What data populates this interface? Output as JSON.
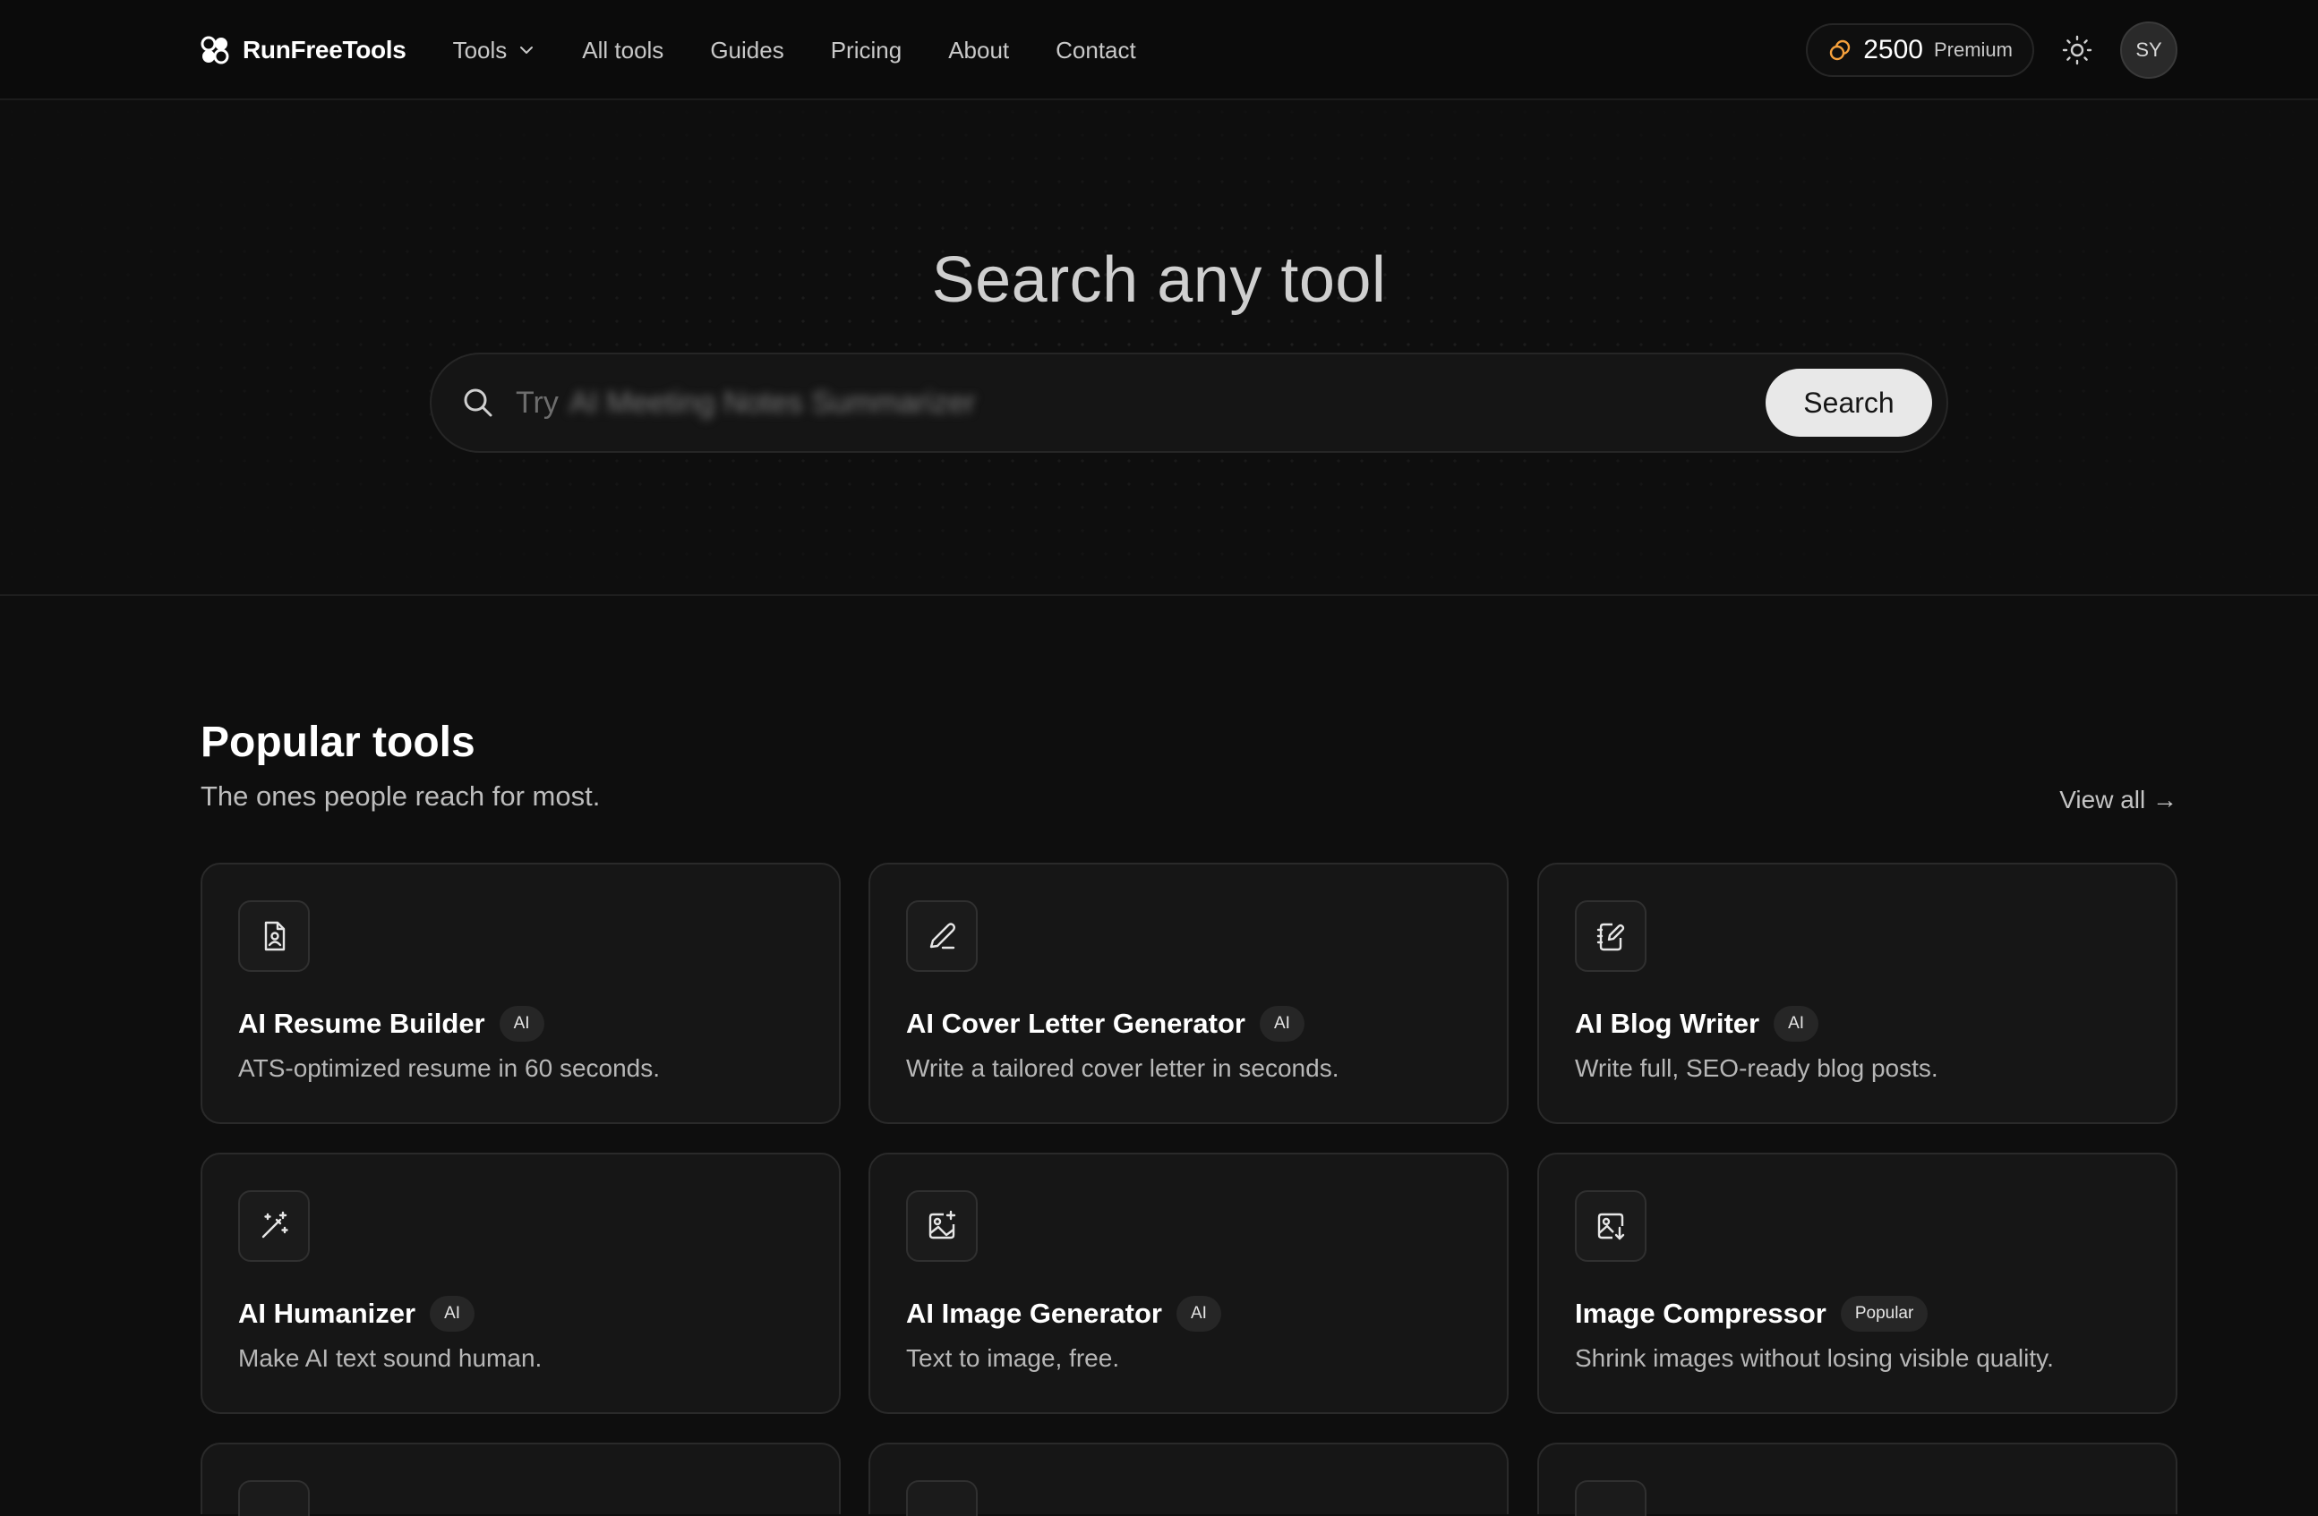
{
  "nav": {
    "brand": "RunFreeTools",
    "links": [
      "Tools",
      "All tools",
      "Guides",
      "Pricing",
      "About",
      "Contact"
    ],
    "credits": {
      "count": "2500",
      "plan": "Premium"
    },
    "avatar_initials": "SY"
  },
  "hero": {
    "title": "Search any tool",
    "search_try": "Try",
    "search_hint": "AI Meeting Notes Summarizer",
    "search_button": "Search"
  },
  "popular": {
    "title": "Popular tools",
    "subtitle": "The ones people reach for most.",
    "view_all": "View all →",
    "cards": [
      {
        "icon": "resume-icon",
        "title": "AI Resume Builder",
        "badge": "AI",
        "desc": "ATS-optimized resume in 60 seconds."
      },
      {
        "icon": "pen-icon",
        "title": "AI Cover Letter Generator",
        "badge": "AI",
        "desc": "Write a tailored cover letter in seconds."
      },
      {
        "icon": "notebook-pen-icon",
        "title": "AI Blog Writer",
        "badge": "AI",
        "desc": "Write full, SEO-ready blog posts."
      },
      {
        "icon": "magic-wand-icon",
        "title": "AI Humanizer",
        "badge": "AI",
        "desc": "Make AI text sound human."
      },
      {
        "icon": "image-plus-icon",
        "title": "AI Image Generator",
        "badge": "AI",
        "desc": "Text to image, free."
      },
      {
        "icon": "image-down-icon",
        "title": "Image Compressor",
        "badge": "Popular",
        "desc": "Shrink images without losing visible quality."
      }
    ]
  },
  "colors": {
    "background": "#0e0e0e",
    "card": "#161616",
    "accent_coin": "#f5a03c"
  }
}
